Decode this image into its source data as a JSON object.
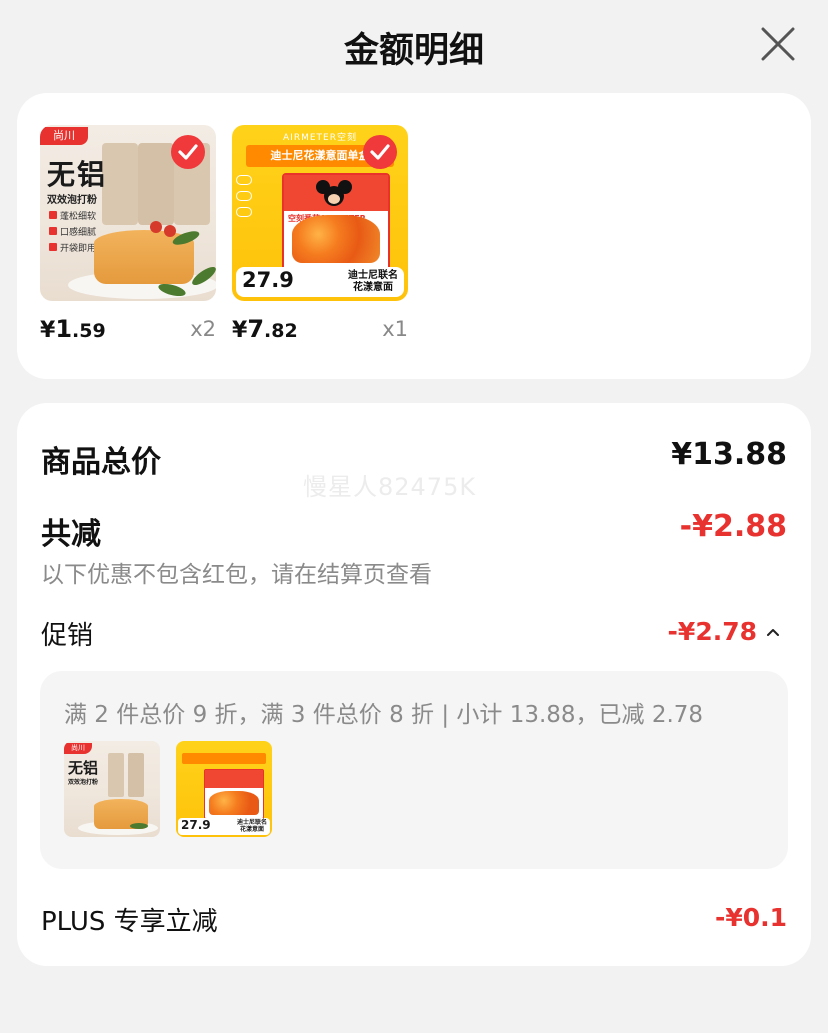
{
  "header": {
    "title": "金额明细",
    "close_icon": "close-icon"
  },
  "products": [
    {
      "image": {
        "brand": "尚川",
        "headline": "无铝",
        "subtitle": "双效泡打粉",
        "tags": [
          "蓬松细软",
          "口感细腻",
          "开袋即用"
        ],
        "pack_text": "双效泡打粉"
      },
      "currency": "¥",
      "price_int": "1",
      "price_dec": ".59",
      "qty": "x2",
      "selected": true
    },
    {
      "image": {
        "brand": "AIRMETER空刻",
        "headline": "迪士尼花漾意面单盒",
        "box_text": "空刻番茄AIRMETER",
        "price": "27.9",
        "name_line1": "迪士尼联名",
        "name_line2": "花漾意面"
      },
      "currency": "¥",
      "price_int": "7",
      "price_dec": ".82",
      "qty": "x1",
      "selected": true
    }
  ],
  "summary": {
    "total_label": "商品总价",
    "total_value": "¥13.88",
    "discount_label": "共减",
    "discount_value": "-¥2.88",
    "discount_hint": "以下优惠不包含红包，请在结算页查看",
    "watermark": "慢星人82475K",
    "promo_label": "促销",
    "promo_value": "-¥2.78",
    "promo_detail": "满 2 件总价 9 折，满 3 件总价 8 折 | 小计 13.88，已减 2.78",
    "plus_label": "PLUS 专享立减",
    "plus_value": "-¥0.1"
  },
  "colors": {
    "accent_red": "#e8322f",
    "background": "#f2f2f2",
    "card": "#ffffff",
    "muted_text": "#8a8a8a"
  }
}
